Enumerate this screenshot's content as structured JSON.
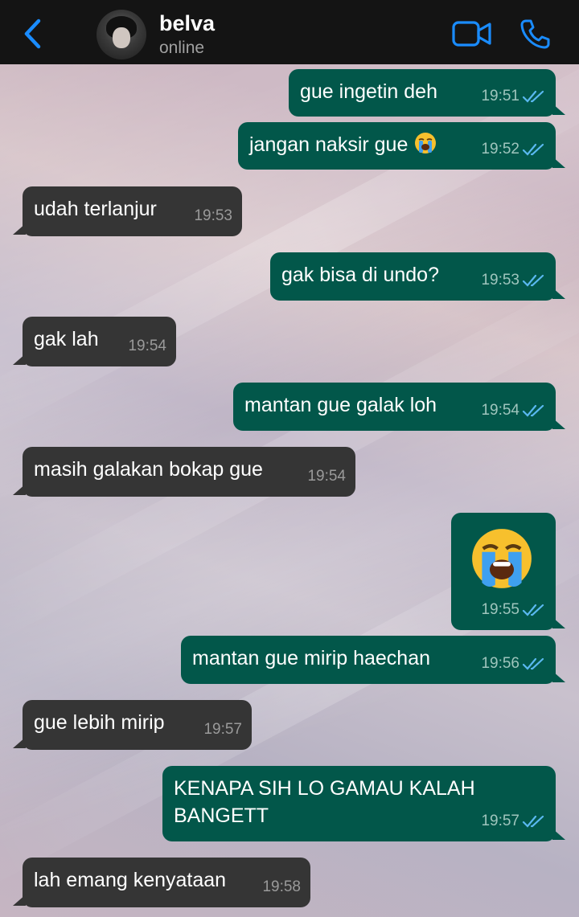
{
  "header": {
    "contact_name": "belva",
    "status": "online"
  },
  "messages": [
    {
      "dir": "out",
      "text": "gue ingetin deh",
      "time": "19:51"
    },
    {
      "dir": "out",
      "text": "jangan naksir gue",
      "emoji": "loudly-crying-face",
      "time": "19:52"
    },
    {
      "dir": "in",
      "text": "udah terlanjur",
      "time": "19:53"
    },
    {
      "dir": "out",
      "text": "gak bisa di undo?",
      "time": "19:53"
    },
    {
      "dir": "in",
      "text": "gak lah",
      "time": "19:54"
    },
    {
      "dir": "out",
      "text": "mantan gue galak loh",
      "time": "19:54"
    },
    {
      "dir": "in",
      "text": "masih galakan bokap gue",
      "time": "19:54"
    },
    {
      "dir": "out",
      "emoji": "loudly-crying-face",
      "time": "19:55"
    },
    {
      "dir": "out",
      "text": "mantan gue mirip haechan",
      "time": "19:56"
    },
    {
      "dir": "in",
      "text": "gue lebih mirip",
      "time": "19:57"
    },
    {
      "dir": "out",
      "text": "KENAPA SIH LO GAMAU KALAH BANGETT",
      "time": "19:57"
    },
    {
      "dir": "in",
      "text": "lah emang kenyataan",
      "time": "19:58"
    }
  ],
  "colors": {
    "header_bg": "#141414",
    "accent": "#1a8cff",
    "outgoing_bubble": "#02574a",
    "incoming_bubble": "#353535",
    "read_ticks": "#5ab8f0"
  }
}
